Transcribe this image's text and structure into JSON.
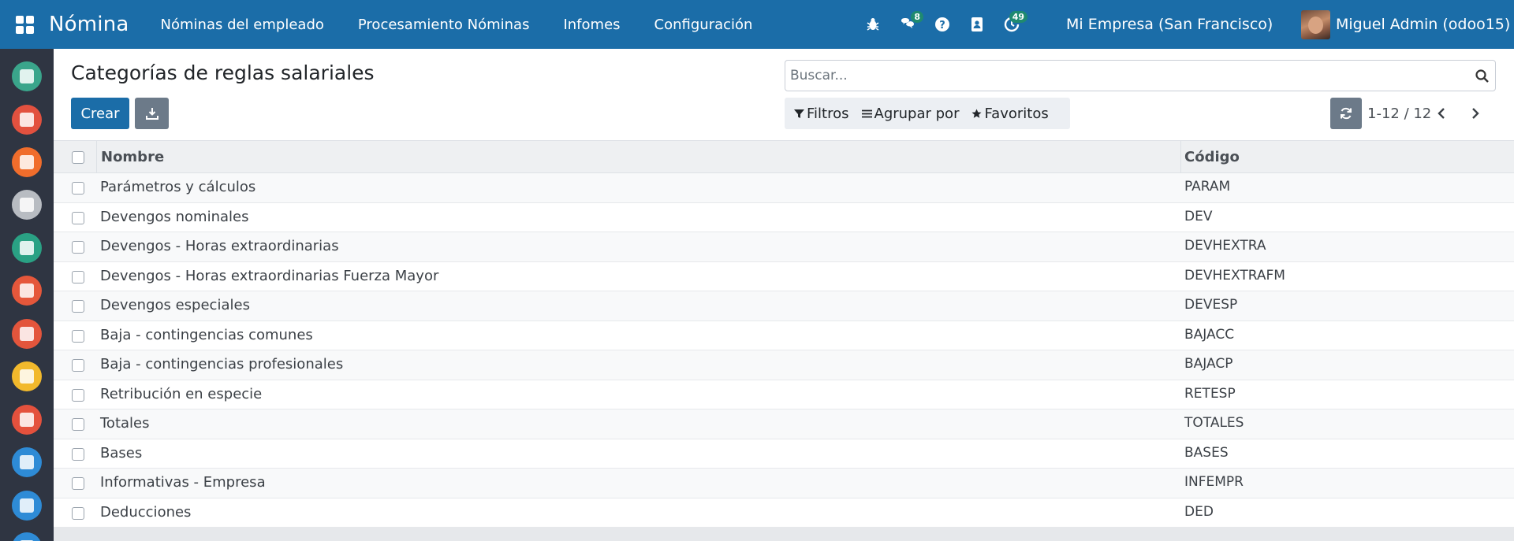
{
  "navbar": {
    "brand": "Nómina",
    "menu": [
      {
        "label": "Nóminas del empleado"
      },
      {
        "label": "Procesamiento Nóminas"
      },
      {
        "label": "Infomes"
      },
      {
        "label": "Configuración"
      }
    ],
    "systray": {
      "messages_badge": "8",
      "activities_badge": "49"
    },
    "company": "Mi Empresa (San Francisco)",
    "user": "Miguel Admin (odoo15)"
  },
  "sidebar": {
    "apps": [
      {
        "icon": "discuss-icon",
        "color": "#3aa58b"
      },
      {
        "icon": "calendar-icon",
        "color": "#e2513f"
      },
      {
        "icon": "notes-icon",
        "color": "#f06d2c"
      },
      {
        "icon": "contacts-icon",
        "color": "#b8bcc2"
      },
      {
        "icon": "employees-icon",
        "color": "#2aa184"
      },
      {
        "icon": "crm-icon",
        "color": "#e5573b"
      },
      {
        "icon": "sales-icon",
        "color": "#e3553c"
      },
      {
        "icon": "dashboard-icon",
        "color": "#f2b92c"
      },
      {
        "icon": "payroll-icon",
        "color": "#e4513d"
      },
      {
        "icon": "pos-icon",
        "color": "#2e8bd6"
      },
      {
        "icon": "accounting-icon",
        "color": "#2e8bd6"
      },
      {
        "icon": "more-app-icon",
        "color": "#2e8bd6"
      }
    ]
  },
  "control": {
    "breadcrumb": "Categorías de reglas salariales",
    "create_label": "Crear",
    "search_placeholder": "Buscar...",
    "filters_label": "Filtros",
    "group_by_label": "Agrupar por",
    "favorites_label": "Favoritos",
    "pager_value": "1-12 / 12"
  },
  "table": {
    "columns": {
      "name": "Nombre",
      "code": "Código"
    },
    "rows": [
      {
        "name": "Parámetros y cálculos",
        "code": "PARAM"
      },
      {
        "name": "Devengos nominales",
        "code": "DEV"
      },
      {
        "name": "Devengos - Horas extraordinarias",
        "code": "DEVHEXTRA"
      },
      {
        "name": "Devengos - Horas extraordinarias Fuerza Mayor",
        "code": "DEVHEXTRAFM"
      },
      {
        "name": "Devengos especiales",
        "code": "DEVESP"
      },
      {
        "name": "Baja - contingencias comunes",
        "code": "BAJACC"
      },
      {
        "name": "Baja - contingencias profesionales",
        "code": "BAJACP"
      },
      {
        "name": "Retribución en especie",
        "code": "RETESP"
      },
      {
        "name": "Totales",
        "code": "TOTALES"
      },
      {
        "name": "Bases",
        "code": "BASES"
      },
      {
        "name": "Informativas - Empresa",
        "code": "INFEMPR"
      },
      {
        "name": "Deducciones",
        "code": "DED"
      }
    ]
  },
  "colors": {
    "primary": "#1b6da8",
    "secondary_button": "#6c7a89",
    "sidebar": "#2f3542",
    "badge": "#1f8a70"
  }
}
